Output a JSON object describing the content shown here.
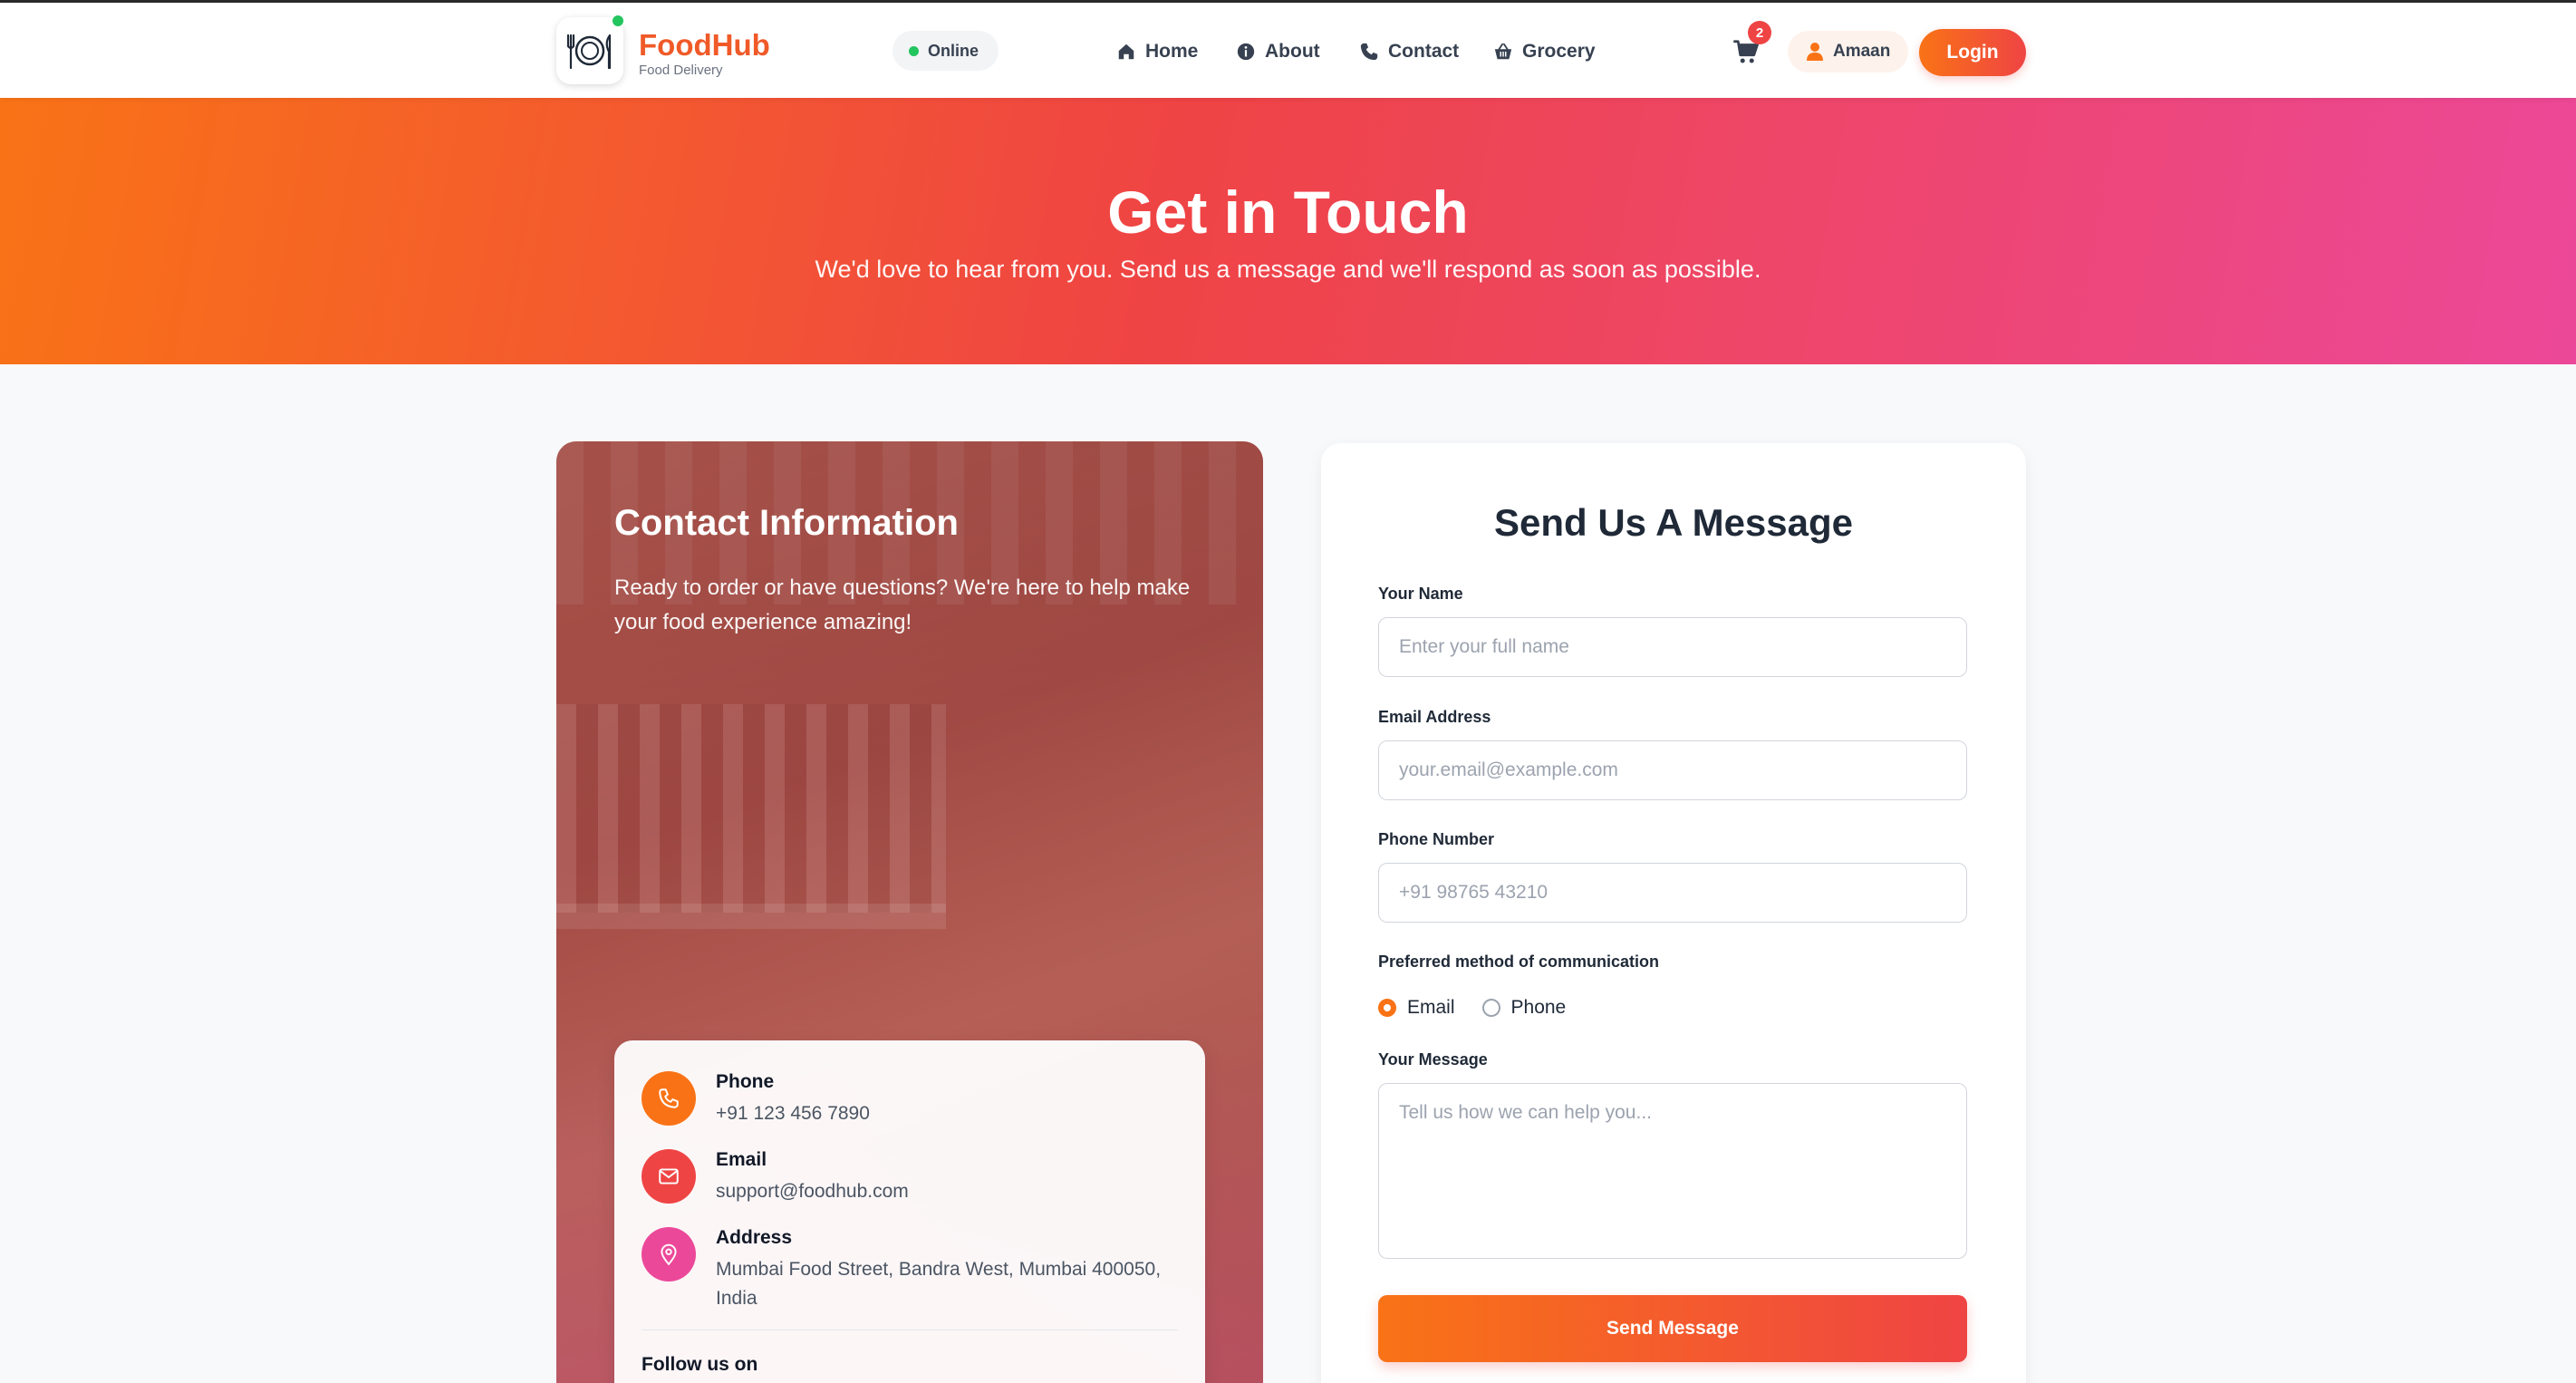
{
  "brand": {
    "name": "FoodHub",
    "tagline": "Food Delivery",
    "logo_icon": "plate-fork-knife-icon"
  },
  "status": {
    "label": "Online",
    "color": "#22c55e"
  },
  "nav": {
    "items": [
      {
        "label": "Home",
        "icon": "home-icon"
      },
      {
        "label": "About",
        "icon": "info-icon"
      },
      {
        "label": "Contact",
        "icon": "phone-icon"
      },
      {
        "label": "Grocery",
        "icon": "basket-icon"
      }
    ]
  },
  "cart": {
    "count": "2",
    "icon": "cart-icon"
  },
  "user": {
    "name": "Amaan",
    "icon": "user-icon"
  },
  "login_label": "Login",
  "hero": {
    "title": "Get in Touch",
    "subtitle": "We'd love to hear from you. Send us a message and we'll respond as soon as possible."
  },
  "contact_info": {
    "title": "Contact Information",
    "description": "Ready to order or have questions? We're here to help make your food experience amazing!",
    "details": [
      {
        "label": "Phone",
        "value": "+91 123 456 7890",
        "icon": "phone-icon",
        "color": "#f97316"
      },
      {
        "label": "Email",
        "value": "support@foodhub.com",
        "icon": "mail-icon",
        "color": "#ef4444"
      },
      {
        "label": "Address",
        "value": "Mumbai Food Street, Bandra West, Mumbai 400050, India",
        "icon": "map-pin-icon",
        "color": "#ec4899"
      }
    ],
    "follow_label": "Follow us on"
  },
  "form": {
    "title": "Send Us A Message",
    "name": {
      "label": "Your Name",
      "placeholder": "Enter your full name",
      "value": ""
    },
    "email": {
      "label": "Email Address",
      "placeholder": "your.email@example.com",
      "value": ""
    },
    "phone": {
      "label": "Phone Number",
      "placeholder": "+91 98765 43210",
      "value": ""
    },
    "method": {
      "label": "Preferred method of communication",
      "options": [
        {
          "label": "Email",
          "selected": true
        },
        {
          "label": "Phone",
          "selected": false
        }
      ]
    },
    "message": {
      "label": "Your Message",
      "placeholder": "Tell us how we can help you...",
      "value": ""
    },
    "submit_label": "Send Message"
  },
  "colors": {
    "accent": "#f97316",
    "accent_red": "#ef4444",
    "accent_pink": "#ec4899"
  }
}
